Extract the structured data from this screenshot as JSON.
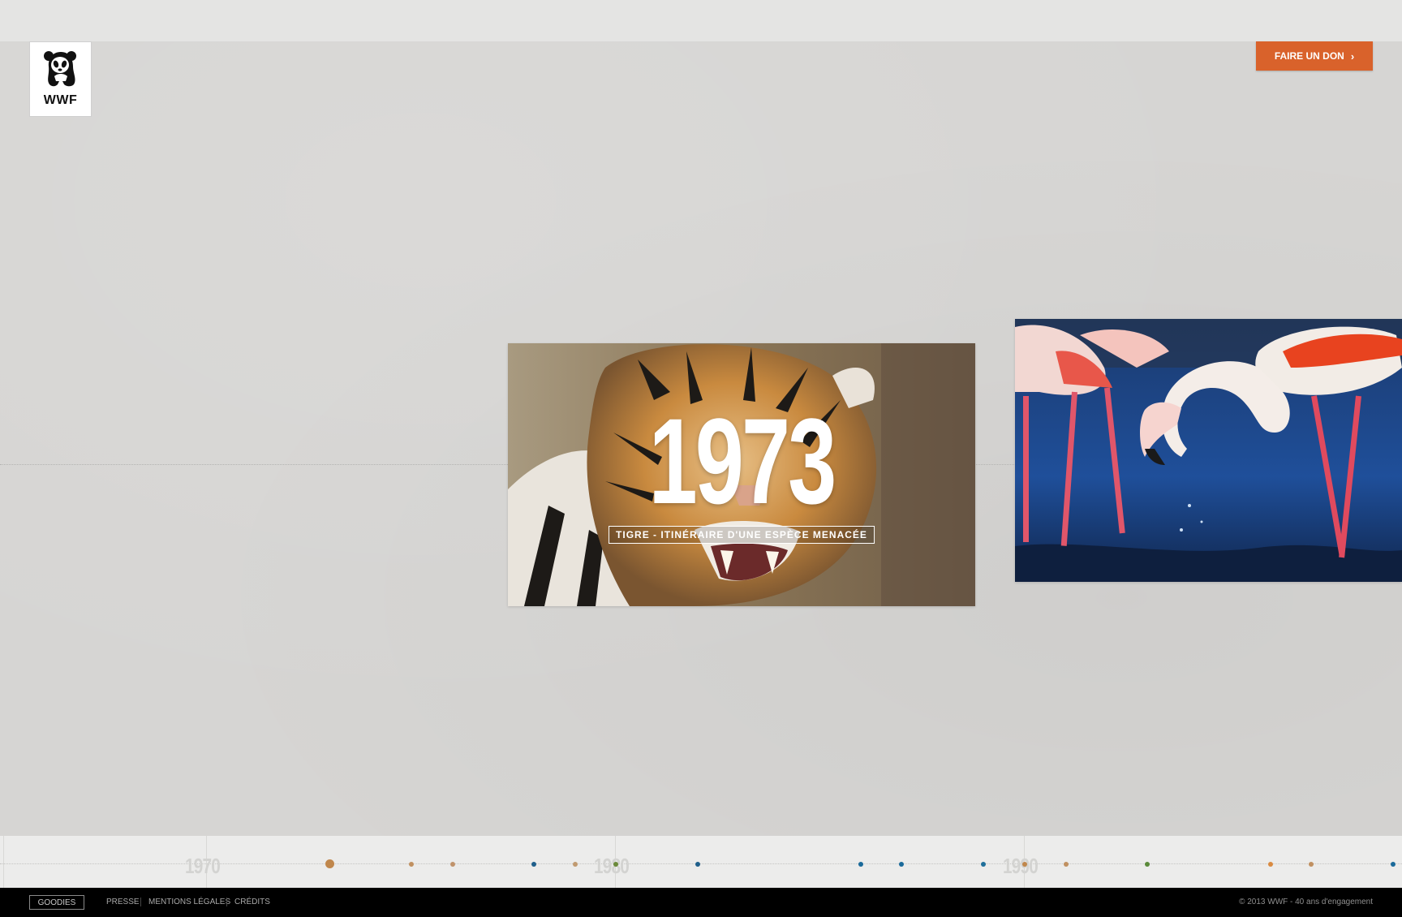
{
  "header": {
    "logo_text": "WWF",
    "donate_label": "FAIRE UN DON",
    "donate_icon": "chevron-right-icon",
    "accent_color": "#d9622b"
  },
  "cards": [
    {
      "id": "tigre",
      "year": "1973",
      "caption": "TIGRE - ITINÉRAIRE D'UNE ESPÈCE MENACÉE"
    },
    {
      "id": "flamant",
      "year": "",
      "caption": ""
    }
  ],
  "scrubber": {
    "decades": [
      "1970",
      "1980",
      "1990"
    ],
    "dot_colors": [
      "#c0874c",
      "#c09060",
      "#c0936b",
      "#1f5f8b",
      "#c09a70",
      "#6b8a3a",
      "#1f5f8b",
      "#1a6a9a",
      "#1a6a9a",
      "#1f6f9a",
      "#c0874c",
      "#c09060",
      "#5a8a3a",
      "#d98a40",
      "#c09060",
      "#1a6a9a"
    ]
  },
  "footer": {
    "goodies": "GOODIES",
    "links": [
      "PRESSE",
      "MENTIONS LÉGALES",
      "CRÉDITS"
    ],
    "copyright": "© 2013 WWF - 40 ans d'engagement"
  }
}
